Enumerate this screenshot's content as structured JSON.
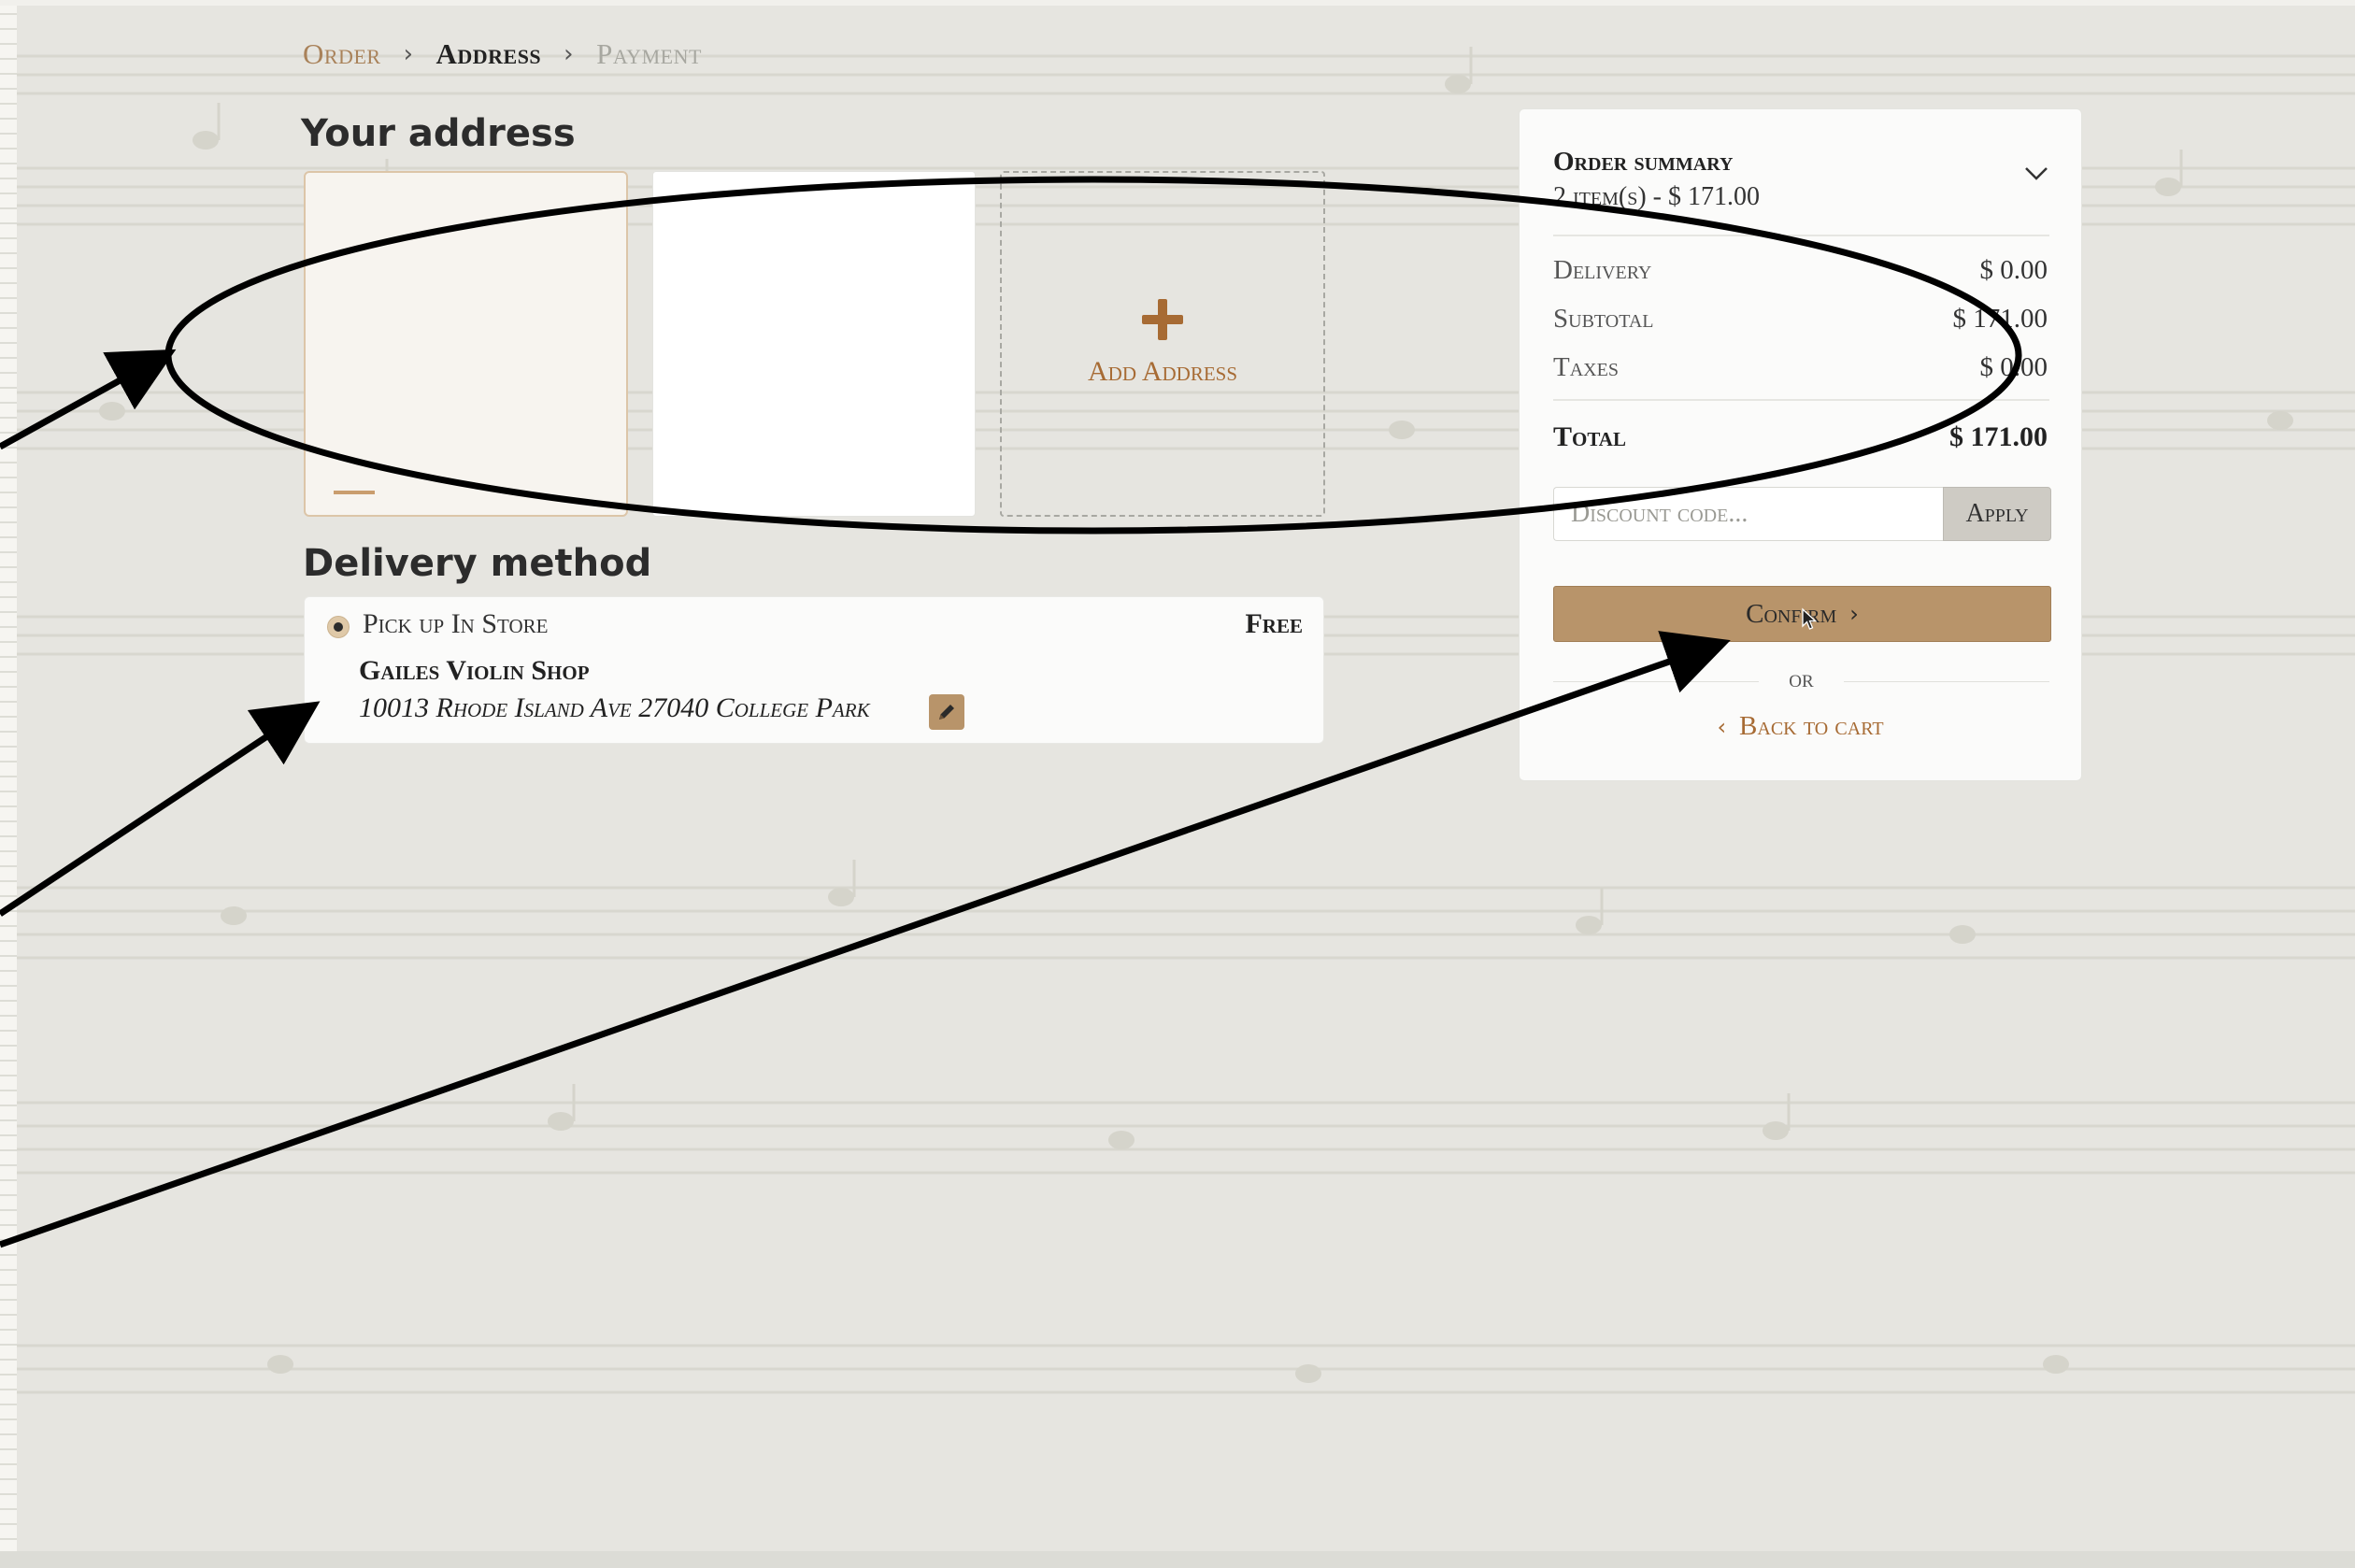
{
  "breadcrumb": {
    "order": "Order",
    "address": "Address",
    "payment": "Payment"
  },
  "address_section": {
    "title": "Your address",
    "add_label": "Add Address"
  },
  "delivery_section": {
    "title": "Delivery method",
    "option_label": "Pick up In Store",
    "option_price": "Free",
    "store_name": "Gailes Violin Shop",
    "store_address": "10013 Rhode Island Ave 27040 College Park"
  },
  "summary": {
    "title": "Order summary",
    "items_line": "2 item(s) -  $ 171.00",
    "rows": [
      {
        "label": "Delivery",
        "value": "$ 0.00"
      },
      {
        "label": "Subtotal",
        "value": "$ 171.00"
      },
      {
        "label": "Taxes",
        "value": "$ 0.00"
      }
    ],
    "total_label": "Total",
    "total_value": "$ 171.00",
    "discount_placeholder": "Discount code...",
    "apply_label": "Apply",
    "confirm_label": "Confirm",
    "or_label": "or",
    "back_label": "Back to cart"
  },
  "colors": {
    "accent": "#b8946a",
    "link": "#a76b34",
    "background": "#e6e5e0",
    "annotation": "#000000"
  },
  "icons": [
    "chevron-right-icon",
    "plus-icon",
    "radio-selected-icon",
    "pencil-icon",
    "chevron-down-icon",
    "chevron-left-icon",
    "mouse-cursor-icon"
  ]
}
